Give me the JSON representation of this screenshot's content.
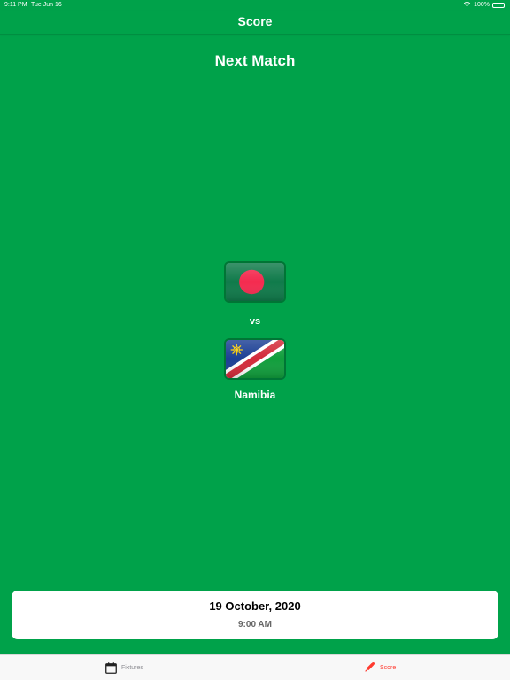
{
  "status_bar": {
    "time": "9:11 PM",
    "date": "Tue Jun 16",
    "battery": "100%"
  },
  "nav": {
    "title": "Score"
  },
  "match": {
    "heading": "Next Match",
    "vs": "vs",
    "team_home_name": "",
    "team_away_name": "Namibia",
    "date": "19 October, 2020",
    "time": "9:00 AM"
  },
  "tabs": [
    {
      "label": "Fixtures",
      "icon": "calendar-icon",
      "selected": false
    },
    {
      "label": "Score",
      "icon": "cricket-bat-icon",
      "selected": true
    }
  ],
  "colors": {
    "background": "#00a24a",
    "active_tab": "#ff3b30",
    "inactive_tab": "#8e8e93"
  }
}
